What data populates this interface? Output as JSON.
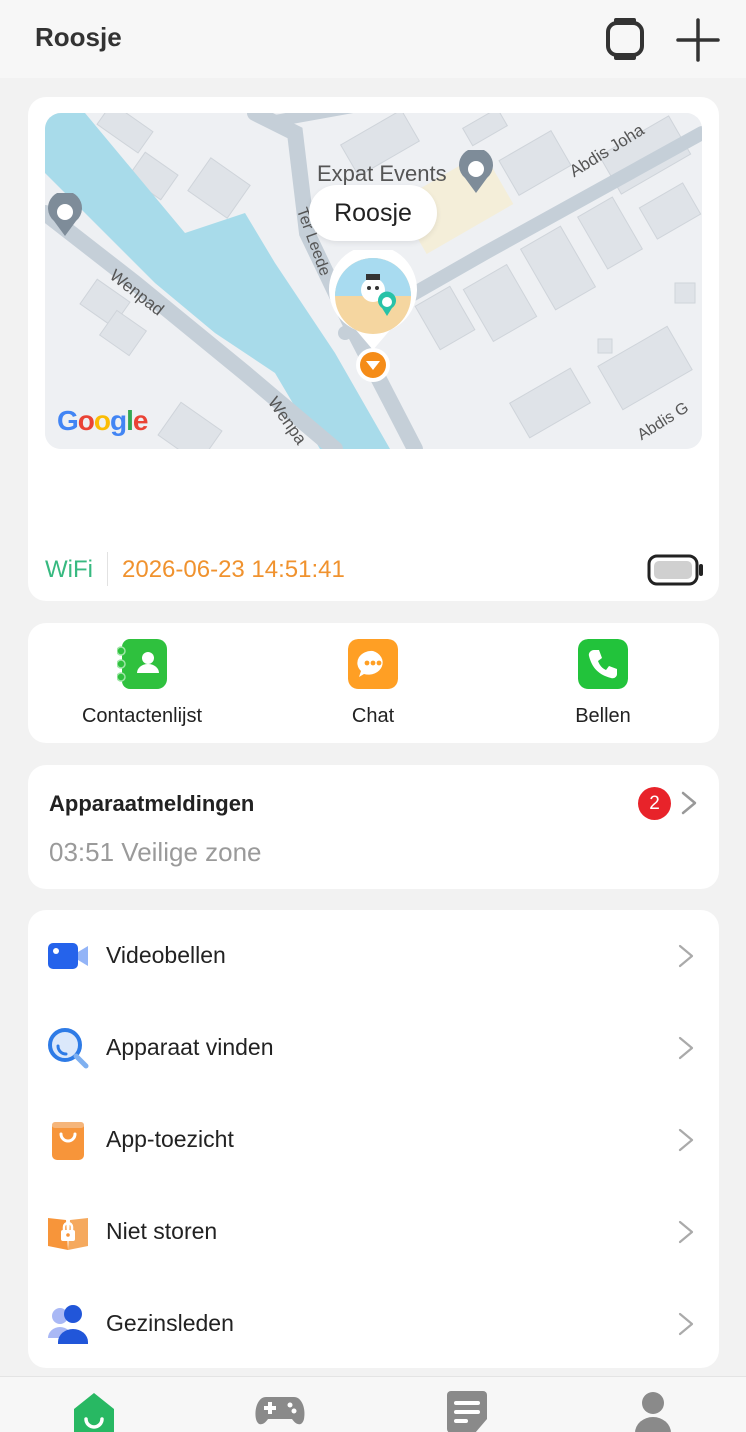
{
  "header": {
    "title": "Roosje",
    "watch_icon": "watch-icon",
    "add_icon": "plus-icon"
  },
  "map": {
    "poi_label": "Expat Events",
    "device_label": "Roosje",
    "streets": [
      "Wenpad",
      "Wenpa",
      "Ter Leede",
      "Abdis Joha",
      "Abdis G"
    ],
    "brand": "Google"
  },
  "status": {
    "connection": "WiFi",
    "timestamp": "2026-06-23 14:51:41",
    "battery_icon": "battery-icon"
  },
  "quick_actions": [
    {
      "label": "Contactenlijst",
      "icon": "contacts-icon",
      "color": "#2fc13e"
    },
    {
      "label": "Chat",
      "icon": "chat-icon",
      "color": "#ff9f24"
    },
    {
      "label": "Bellen",
      "icon": "phone-icon",
      "color": "#22c33b"
    }
  ],
  "alerts": {
    "title": "Apparaatmeldingen",
    "count": "2",
    "latest": "03:51 Veilige zone"
  },
  "menu": [
    {
      "label": "Videobellen",
      "icon": "video-camera-icon"
    },
    {
      "label": "Apparaat vinden",
      "icon": "magnifier-icon"
    },
    {
      "label": "App-toezicht",
      "icon": "shopping-bag-icon"
    },
    {
      "label": "Niet storen",
      "icon": "lock-book-icon"
    },
    {
      "label": "Gezinsleden",
      "icon": "family-icon"
    }
  ],
  "tabs": [
    {
      "name": "home",
      "icon": "home-icon",
      "active": true,
      "color": "#28b863"
    },
    {
      "name": "games",
      "icon": "gamepad-icon",
      "active": false,
      "color": "#8a8a8a"
    },
    {
      "name": "messages",
      "icon": "notes-icon",
      "active": false,
      "color": "#8a8a8a"
    },
    {
      "name": "profile",
      "icon": "person-icon",
      "active": false,
      "color": "#8a8a8a"
    }
  ]
}
